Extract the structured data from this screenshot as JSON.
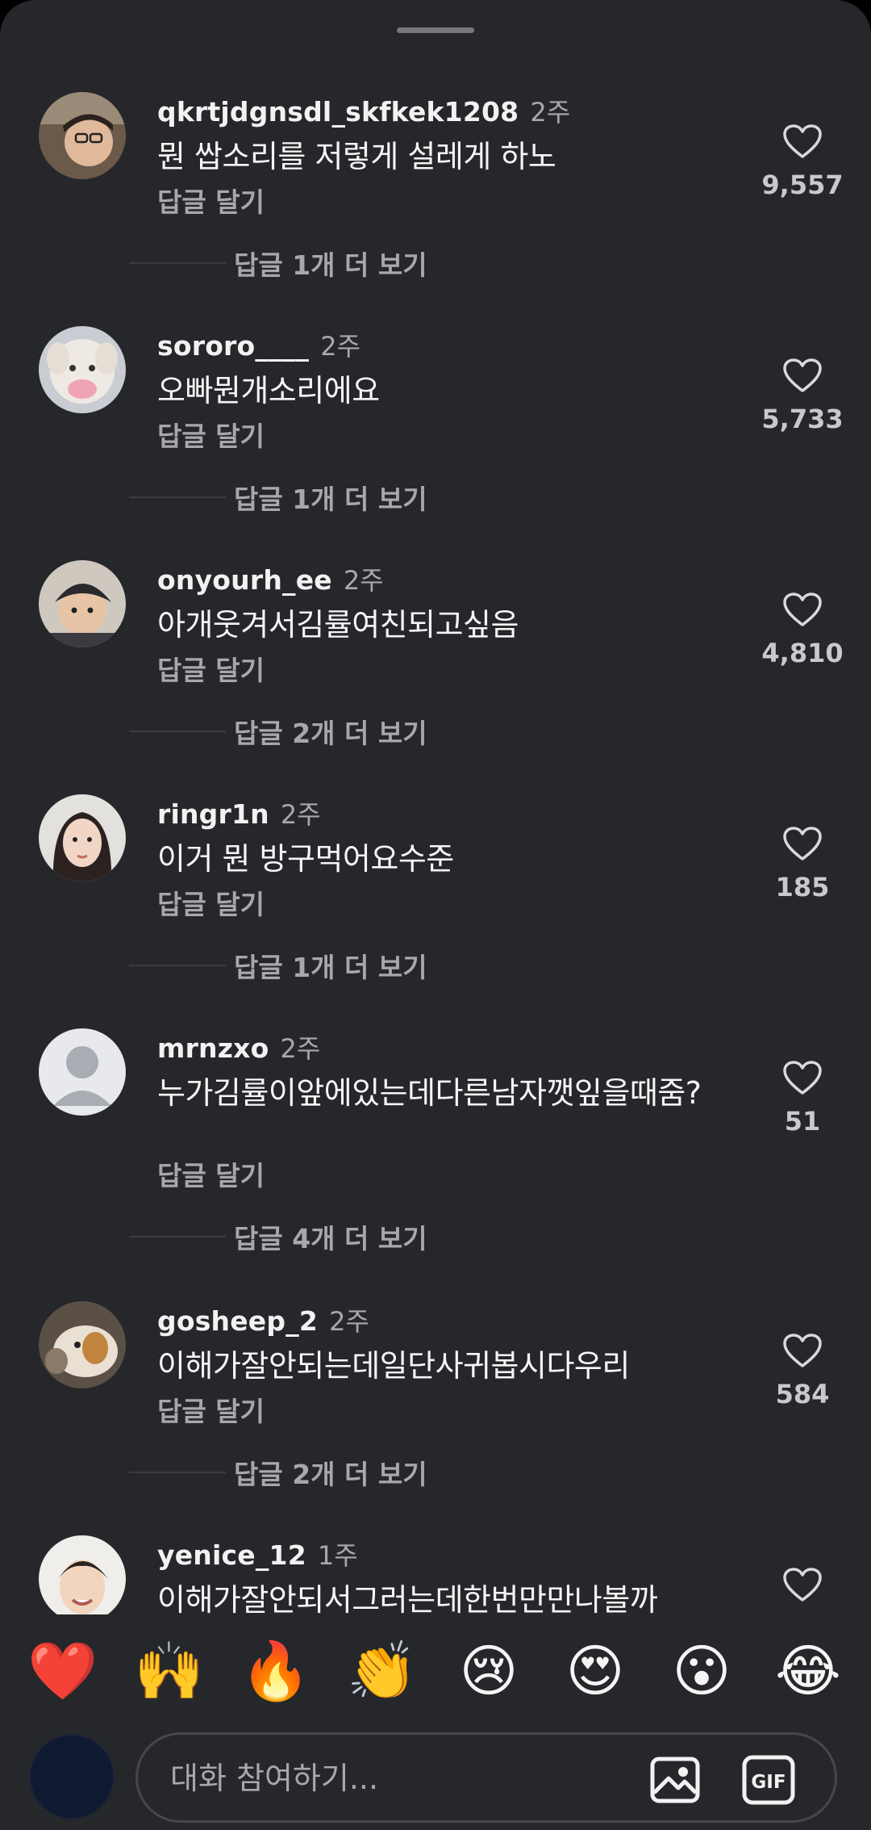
{
  "comments": [
    {
      "username": "qkrtjdgnsdl_skfkek1208",
      "time": "2주",
      "text": "뭔 쌉소리를 저렇게 설레게 하노",
      "reply": "답글 달기",
      "likes": "9,557",
      "more_replies": "답글 1개 더 보기"
    },
    {
      "username": "sororo____",
      "time": "2주",
      "text": "오빠뭔개소리에요",
      "reply": "답글 달기",
      "likes": "5,733",
      "more_replies": "답글 1개 더 보기"
    },
    {
      "username": "onyourh_ee",
      "time": "2주",
      "text": "아개웃겨서김률여친되고싶음",
      "reply": "답글 달기",
      "likes": "4,810",
      "more_replies": "답글 2개 더 보기"
    },
    {
      "username": "ringr1n",
      "time": "2주",
      "text": "이거 뭔 방구먹어요수준",
      "reply": "답글 달기",
      "likes": "185",
      "more_replies": "답글 1개 더 보기"
    },
    {
      "username": "mrnzxo",
      "time": "2주",
      "text": "누가김률이앞에있는데다른남자깻잎을때줌?",
      "reply": "답글 달기",
      "likes": "51",
      "more_replies": "답글 4개 더 보기"
    },
    {
      "username": "gosheep_2",
      "time": "2주",
      "text": "이해가잘안되는데일단사귀봅시다우리",
      "reply": "답글 달기",
      "likes": "584",
      "more_replies": "답글 2개 더 보기"
    },
    {
      "username": "yenice_12",
      "time": "1주",
      "text": "이해가잘안되서그러는데한번만만나볼까",
      "reply": "",
      "likes": "",
      "more_replies": ""
    }
  ],
  "emoji_reactions": [
    "❤️",
    "🙌",
    "🔥",
    "👏",
    "😢",
    "😍",
    "😮",
    "😂"
  ],
  "composer": {
    "placeholder": "대화 참여하기...",
    "image_icon": "image-icon",
    "gif_icon": "gif-icon"
  },
  "colors": {
    "sheet_background": "#26272b",
    "primary_text": "#f5f5f5",
    "secondary_text": "#a7a8ab"
  }
}
